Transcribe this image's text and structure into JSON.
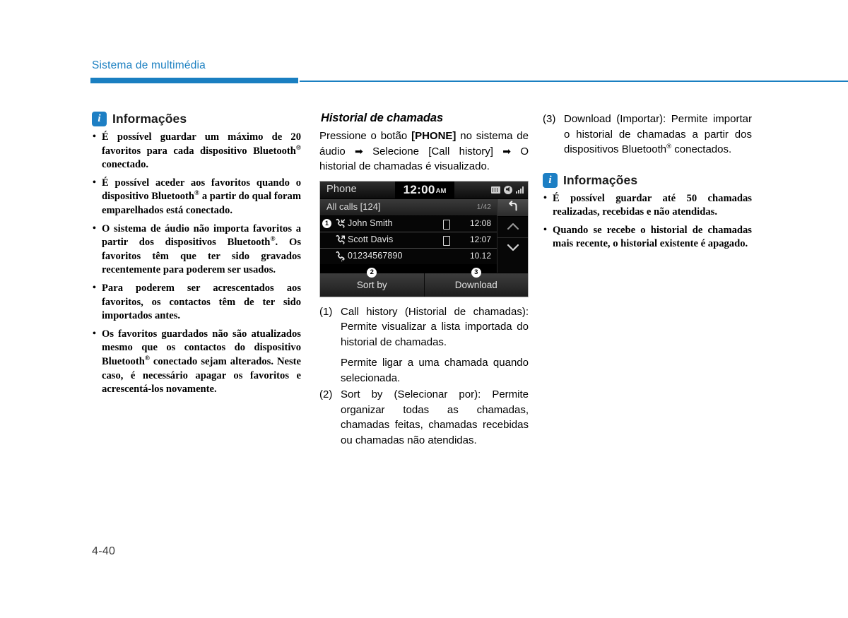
{
  "header": {
    "chapter_title": "Sistema de multimédia",
    "rule_color": "#1a7fc1"
  },
  "left_column": {
    "info_box": {
      "icon": "info-icon",
      "icon_letter": "i",
      "title": "Informações",
      "bullets": [
        "É possível guardar um máximo de 20 favoritos para cada dispositivo Bluetooth® conectado.",
        "É possível aceder aos favoritos quando o dispositivo Bluetooth® a partir do qual foram emparelhados está conectado.",
        "O sistema de áudio não importa favoritos a partir dos dispositivos Bluetooth®. Os favoritos têm que ter sido gravados recentemente para poderem ser usados.",
        "Para poderem ser acrescentados aos favoritos, os contactos têm de ter sido importados antes.",
        "Os favoritos guardados não são atualizados mesmo que os contactos do dispositivo Bluetooth® conectado sejam alterados. Neste caso, é necessário apagar os favoritos e acrescentá-los novamente."
      ]
    }
  },
  "middle_column": {
    "section_title": "Historial de chamadas",
    "intro_parts": {
      "p1": "Pressione o botão ",
      "button": "[PHONE]",
      "p2": " no sistema de áudio ",
      "arrow1": "➡",
      "p3": " Selecione [Call history] ",
      "arrow2": "➡",
      "p4": " O historial de chamadas é visualizado."
    },
    "screenshot": {
      "app_name": "Phone",
      "clock_time": "12:00",
      "clock_meridiem": "AM",
      "status_icons": [
        "sd-card-icon",
        "mute-icon",
        "signal-icon"
      ],
      "list_header": {
        "label": "All calls [124]",
        "page_count": "1/42"
      },
      "back_icon": "back-arrow-icon",
      "scroll_up_icon": "chevron-up-icon",
      "scroll_down_icon": "chevron-down-icon",
      "rows": [
        {
          "callout": "1",
          "call_type_icon": "incoming-call-icon",
          "name": "John Smith",
          "device_icon": "mobile-icon",
          "time": "12:08"
        },
        {
          "callout": "",
          "call_type_icon": "outgoing-call-icon",
          "name": "Scott Davis",
          "device_icon": "mobile-icon",
          "time": "12:07"
        },
        {
          "callout": "",
          "call_type_icon": "missed-call-icon",
          "name": "01234567890",
          "device_icon": "",
          "time": "10.12"
        }
      ],
      "bottom_buttons": [
        {
          "callout": "2",
          "label": "Sort by"
        },
        {
          "callout": "3",
          "label": "Download"
        }
      ]
    },
    "numbered_items": [
      {
        "marker": "(1)",
        "text": "Call history (Historial de chamadas): Permite visualizar a lista importada do historial de chamadas.",
        "extra": "Permite ligar a uma chamada quando selecionada."
      },
      {
        "marker": "(2)",
        "text": "Sort by (Selecionar por): Permite organizar todas as chamadas, chamadas feitas, chamadas recebidas ou chamadas não atendidas.",
        "extra": ""
      }
    ]
  },
  "right_column": {
    "numbered_items": [
      {
        "marker": "(3)",
        "text_before": "Download (Importar): Permite importar o historial de chamadas a partir dos dispositivos Bluetooth",
        "text_after": " conectados."
      }
    ],
    "info_box": {
      "icon": "info-icon",
      "icon_letter": "i",
      "title": "Informações",
      "bullets": [
        "É possível guardar até 50 chamadas realizadas, recebidas e não atendidas.",
        "Quando se recebe o historial de chamadas mais recente, o historial existente é apagado."
      ]
    }
  },
  "footer": {
    "page_number": "4-40"
  }
}
